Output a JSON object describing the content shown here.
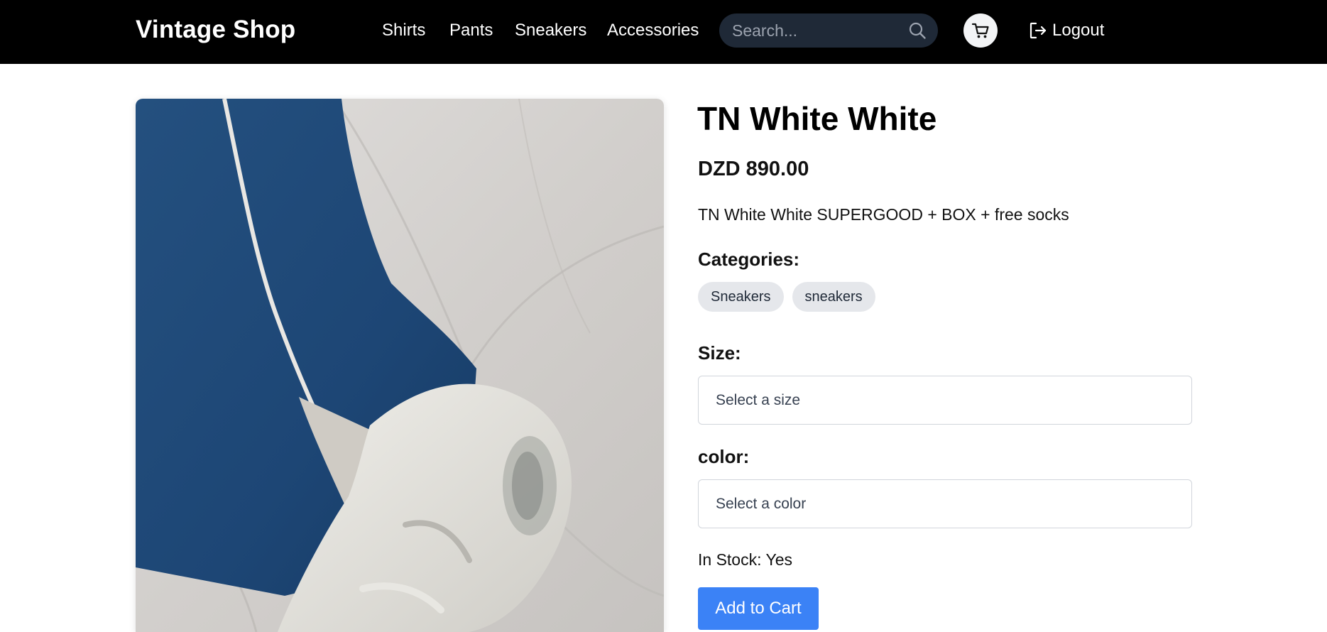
{
  "header": {
    "brand": "Vintage Shop",
    "nav": [
      {
        "label": "Shirts"
      },
      {
        "label": "Pants"
      },
      {
        "label": "Sneakers"
      },
      {
        "label": "Accessories"
      }
    ],
    "search": {
      "placeholder": "Search...",
      "value": "",
      "icon": "search-icon"
    },
    "cart": {
      "icon": "cart-icon"
    },
    "logout": {
      "label": "Logout",
      "icon": "logout-icon"
    }
  },
  "product": {
    "title": "TN White White",
    "price": "DZD 890.00",
    "description": "TN White White SUPERGOOD + BOX + free socks",
    "categories_label": "Categories:",
    "categories": [
      "Sneakers",
      "sneakers"
    ],
    "size_label": "Size:",
    "size_placeholder": "Select a size",
    "color_label": "color:",
    "color_placeholder": "Select a color",
    "stock_label": "In Stock:",
    "stock_value": "Yes",
    "add_to_cart": "Add to Cart"
  },
  "colors": {
    "navbar_bg": "#000000",
    "search_bg": "#1f2937",
    "accent": "#3b82f6",
    "chip_bg": "#e5e7eb"
  }
}
